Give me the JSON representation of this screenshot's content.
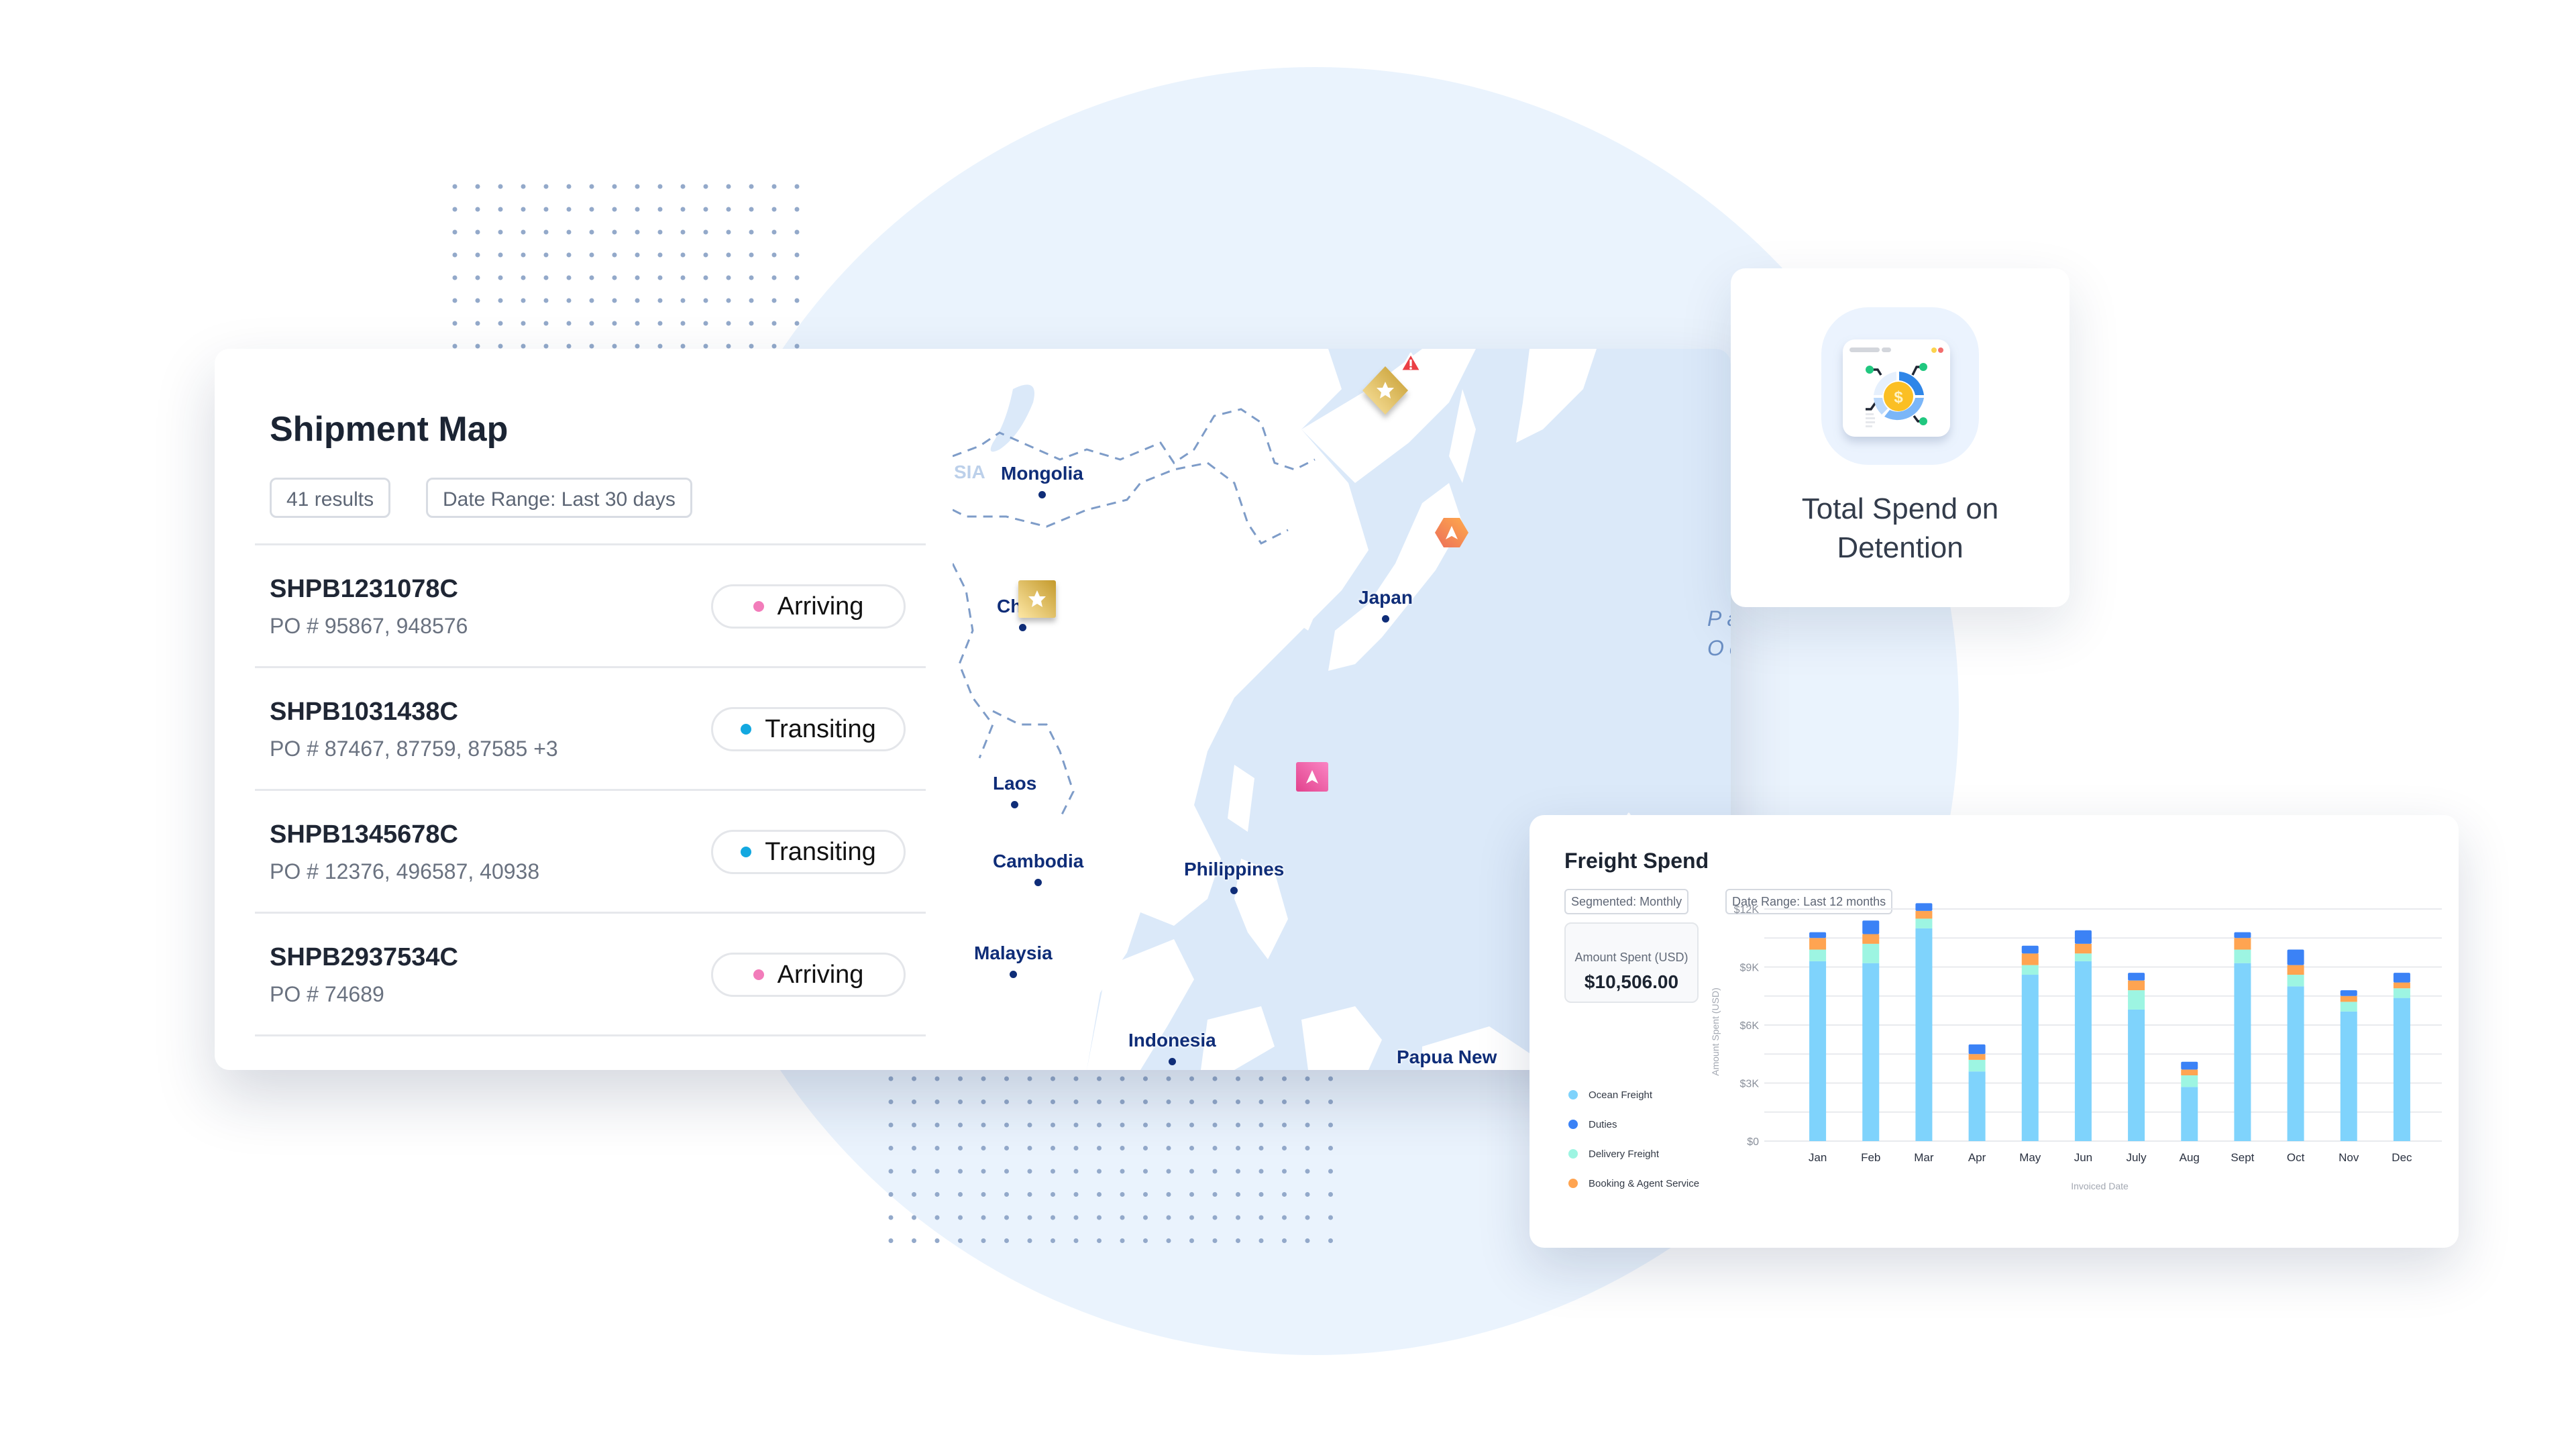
{
  "shipment_map": {
    "title": "Shipment Map",
    "results_chip": "41 results",
    "date_range_chip": "Date Range: Last 30 days",
    "status_colors": {
      "Arriving": "#f27cba",
      "Transiting": "#13a8e0"
    },
    "shipments": [
      {
        "id": "SHPB1231078C",
        "po": "PO # 95867, 948576",
        "status": "Arriving"
      },
      {
        "id": "SHPB1031438C",
        "po": "PO # 87467, 87759, 87585 +3",
        "status": "Transiting"
      },
      {
        "id": "SHPB1345678C",
        "po": "PO # 12376, 496587, 40938",
        "status": "Transiting"
      },
      {
        "id": "SHPB2937534C",
        "po": "PO # 74689",
        "status": "Arriving"
      }
    ],
    "map": {
      "labels": [
        "Mongolia",
        "China",
        "Japan",
        "Laos",
        "Cambodia",
        "Philippines",
        "Malaysia",
        "Indonesia",
        "Papua New"
      ],
      "faded_label": "SIA",
      "ocean_label_lines": [
        "Pac",
        "Oc"
      ],
      "markers": [
        {
          "name": "orange-hexagon-marker",
          "icon": "navigation-arrow",
          "color": "#f07f52"
        },
        {
          "name": "gold-square-marker",
          "icon": "star",
          "color": "#d4aa4c"
        },
        {
          "name": "gold-diamond-marker",
          "icon": "star",
          "color": "#d4aa4c",
          "alert": true
        },
        {
          "name": "purple-diamond-marker-north",
          "icon": "play-arrow",
          "color": "#6a3fd6"
        },
        {
          "name": "purple-diamond-marker-east",
          "icon": "play-arrow",
          "color": "#6a3fd6"
        },
        {
          "name": "pink-square-marker",
          "icon": "navigation-arrow",
          "color": "#ea5aa0"
        },
        {
          "name": "blue-circle-marker",
          "icon": "navigation-arrow",
          "color": "#1d9bf0",
          "alert": true
        },
        {
          "name": "gold-circle-marker",
          "icon": "star",
          "color": "#d4aa4c"
        }
      ]
    }
  },
  "detention_card": {
    "title_line1": "Total Spend on",
    "title_line2": "Detention",
    "icon": "dollar-analytics-icon"
  },
  "freight_spend": {
    "title": "Freight Spend",
    "segmented_chip": "Segmented: Monthly",
    "date_range_chip": "Date Range: Last 12 months",
    "kpi_label": "Amount Spent (USD)",
    "kpi_value": "$10,506.00"
  },
  "chart_data": {
    "type": "bar",
    "stacked": true,
    "title": "Freight Spend",
    "xlabel": "Invoiced Date",
    "ylabel": "Amount Spent (USD)",
    "ylim": [
      0,
      12000
    ],
    "yticks": [
      0,
      3000,
      6000,
      9000,
      12000
    ],
    "ytick_labels": [
      "$0",
      "$3K",
      "$6K",
      "$9K",
      "$12K"
    ],
    "grid": true,
    "legend_position": "left",
    "categories": [
      "Jan",
      "Feb",
      "Mar",
      "Apr",
      "May",
      "Jun",
      "July",
      "Aug",
      "Sept",
      "Oct",
      "Nov",
      "Dec"
    ],
    "series": [
      {
        "name": "Ocean Freight",
        "color": "#7fd3fc",
        "values": [
          9300,
          9200,
          11000,
          3600,
          8600,
          9300,
          6800,
          2800,
          9200,
          8000,
          6700,
          7400
        ]
      },
      {
        "name": "Delivery Freight",
        "color": "#9df5e2",
        "values": [
          600,
          1000,
          500,
          600,
          500,
          400,
          1000,
          600,
          700,
          600,
          500,
          500
        ]
      },
      {
        "name": "Booking & Agent Service",
        "color": "#ffa451",
        "values": [
          600,
          500,
          400,
          300,
          600,
          500,
          500,
          300,
          600,
          500,
          300,
          300
        ]
      },
      {
        "name": "Duties",
        "color": "#3b82f6",
        "values": [
          300,
          700,
          400,
          500,
          400,
          700,
          400,
          400,
          300,
          800,
          300,
          500
        ]
      }
    ]
  }
}
